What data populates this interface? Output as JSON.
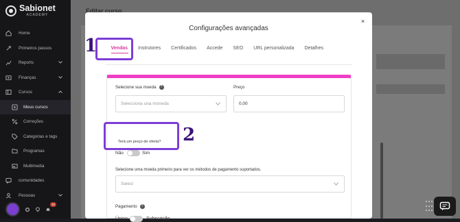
{
  "brand": {
    "name": "Sabionet",
    "sub": "ACADEMY"
  },
  "sidebar": {
    "items": [
      {
        "label": "Home"
      },
      {
        "label": "Primeiros passos"
      },
      {
        "label": "Reports"
      },
      {
        "label": "Finanças"
      },
      {
        "label": "Cursos"
      },
      {
        "label": "Meus cursos"
      },
      {
        "label": "Correções"
      },
      {
        "label": "Categorias e tags"
      },
      {
        "label": "Programas"
      },
      {
        "label": "Multimedia"
      },
      {
        "label": "comunidades"
      },
      {
        "label": "Pessoas"
      }
    ],
    "notification_count": "20"
  },
  "page": {
    "title": "Editar curso"
  },
  "modal": {
    "title": "Configurações avançadas",
    "close": "×",
    "tabs": [
      "Vendas",
      "Instrutores",
      "Certificados",
      "Accede",
      "SEO",
      "URL personalizada",
      "Detalhes"
    ],
    "active_tab": "Vendas",
    "currency_label": "Selecione sua moeda",
    "currency_placeholder": "Selecciona una moneda",
    "price_label": "Preço",
    "price_value": "0,00",
    "offer_label": "Terá um preço de oferta?",
    "offer_no": "Não",
    "offer_yes": "Sim",
    "payment_method_label": "Selecione uma moeda primeiro para ver os métodos de pagamento suportados.",
    "payment_method_placeholder": "Select",
    "payment_label": "Pagamento",
    "payment_single": "Único",
    "payment_subscription": "Subscrição"
  },
  "annotations": {
    "one": "1",
    "two": "2"
  },
  "colors": {
    "accent": "#d63c9f",
    "annotation": "#7c3cd6",
    "panel_top": "#f03fc6"
  }
}
